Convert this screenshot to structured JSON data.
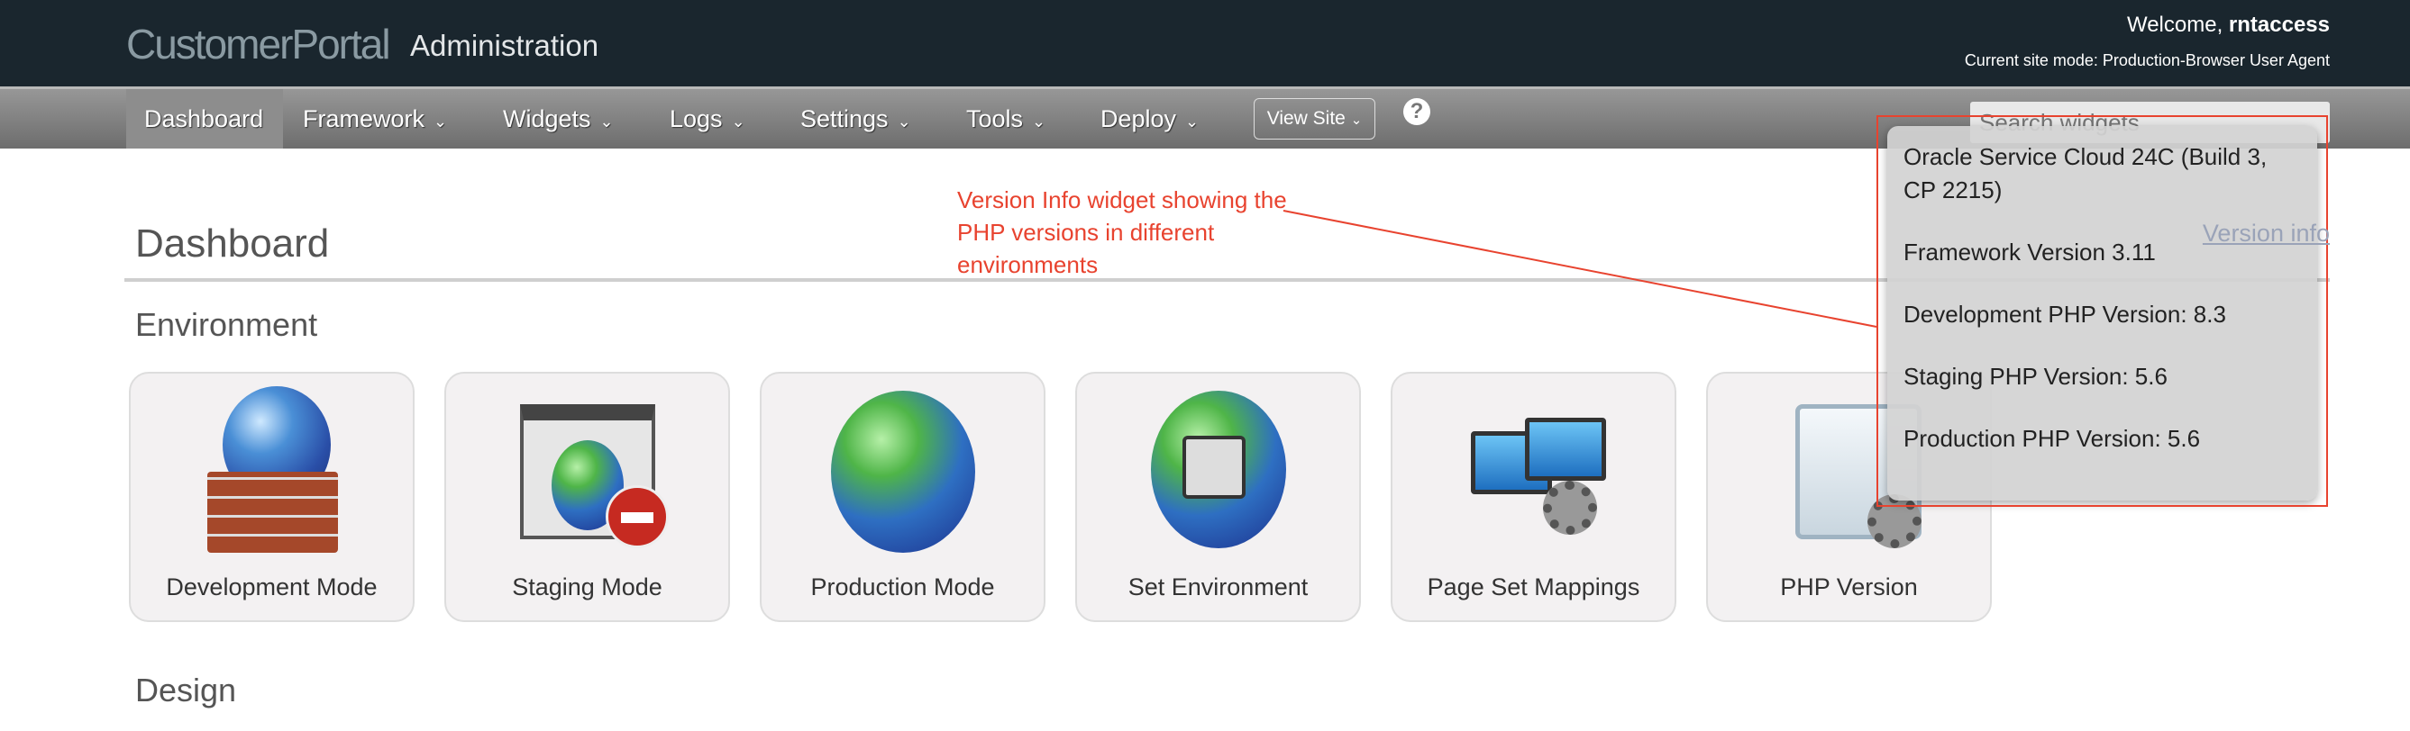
{
  "header": {
    "brand": "CustomerPortal",
    "subtitle": "Administration",
    "welcome_prefix": "Welcome,",
    "username": "rntaccess",
    "site_mode": "Current site mode: Production-Browser User Agent"
  },
  "nav": {
    "items": [
      {
        "label": "Dashboard"
      },
      {
        "label": "Framework"
      },
      {
        "label": "Widgets"
      },
      {
        "label": "Logs"
      },
      {
        "label": "Settings"
      },
      {
        "label": "Tools"
      },
      {
        "label": "Deploy"
      }
    ],
    "view_site": "View Site",
    "help": "?",
    "search_placeholder": "Search widgets"
  },
  "main": {
    "title": "Dashboard",
    "version_link": "Version info",
    "sections": [
      {
        "title": "Environment"
      },
      {
        "title": "Design"
      }
    ],
    "cards": [
      {
        "label": "Development Mode",
        "icon": "globe-firewall-icon"
      },
      {
        "label": "Staging Mode",
        "icon": "globe-window-stop-icon"
      },
      {
        "label": "Production Mode",
        "icon": "globe-icon"
      },
      {
        "label": "Set Environment",
        "icon": "globe-switch-icon"
      },
      {
        "label": "Page Set Mappings",
        "icon": "monitors-gear-icon"
      },
      {
        "label": "PHP Version",
        "icon": "window-gear-icon"
      }
    ]
  },
  "version_popup": {
    "lines": [
      "Oracle Service Cloud 24C (Build 3, CP 2215)",
      "Framework Version 3.11",
      "Development PHP Version: 8.3",
      "Staging PHP Version: 5.6",
      "Production PHP Version: 5.6"
    ]
  },
  "annotation": {
    "text": "Version Info widget showing the PHP versions in different environments",
    "color": "#e8432f"
  }
}
